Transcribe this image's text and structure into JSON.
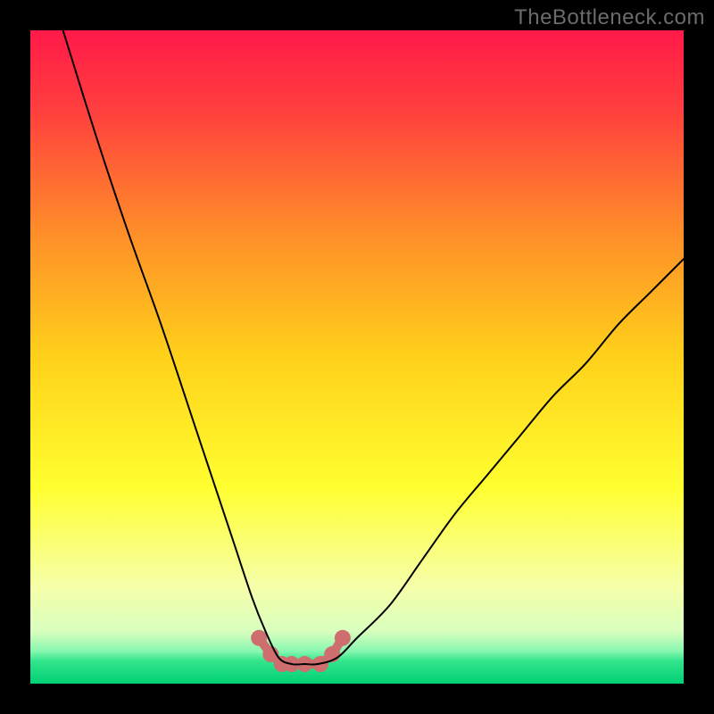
{
  "source_watermark": "TheBottleneck.com",
  "chart_data": {
    "type": "line",
    "title": "",
    "xlabel": "",
    "ylabel": "",
    "xlim": [
      0,
      100
    ],
    "ylim": [
      0,
      100
    ],
    "grid": false,
    "legend": false,
    "axes_visible": false,
    "background_gradient": {
      "stops": [
        {
          "pos": 0.0,
          "color": "#ff1a49"
        },
        {
          "pos": 0.12,
          "color": "#ff3e3e"
        },
        {
          "pos": 0.3,
          "color": "#ff8a2a"
        },
        {
          "pos": 0.5,
          "color": "#ffd11a"
        },
        {
          "pos": 0.7,
          "color": "#ffff30"
        },
        {
          "pos": 0.85,
          "color": "#f6ffa8"
        },
        {
          "pos": 0.92,
          "color": "#d9ffbf"
        },
        {
          "pos": 0.95,
          "color": "#88f7b0"
        },
        {
          "pos": 0.965,
          "color": "#33e58c"
        },
        {
          "pos": 1.0,
          "color": "#00d074"
        }
      ]
    },
    "series": [
      {
        "name": "bottleneck-curve",
        "color": "#000000",
        "stroke_width": 2,
        "x": [
          5,
          10,
          15,
          20,
          25,
          28,
          31,
          34,
          36,
          38,
          40,
          42,
          44,
          47,
          50,
          55,
          60,
          65,
          70,
          75,
          80,
          85,
          90,
          95,
          100
        ],
        "y": [
          100,
          84,
          69,
          55,
          40,
          31,
          22,
          13,
          8,
          4,
          3,
          3,
          3,
          4,
          7,
          12,
          19,
          26,
          32,
          38,
          44,
          49,
          55,
          60,
          65
        ]
      }
    ],
    "markers": {
      "name": "trough-markers",
      "color": "#cf6e6e",
      "radius": 9,
      "stroke_width": 10,
      "x": [
        35.0,
        36.8,
        38.5,
        40.0,
        42.0,
        44.4,
        46.2,
        47.8
      ],
      "y": [
        7.0,
        4.5,
        3.0,
        3.0,
        3.0,
        3.0,
        4.5,
        7.0
      ]
    }
  }
}
